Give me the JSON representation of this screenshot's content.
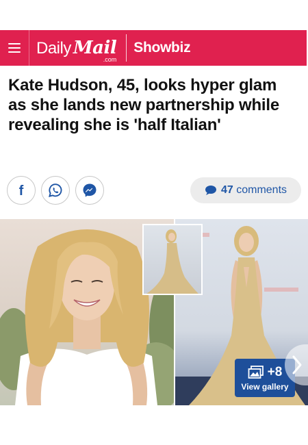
{
  "header": {
    "logo_daily": "Daily",
    "logo_mail": "Mail",
    "logo_com": ".com",
    "section": "Showbiz",
    "brand_color": "#e0214f"
  },
  "article": {
    "headline": "Kate Hudson, 45, looks hyper glam as she lands new partnership while revealing she is 'half Italian'"
  },
  "share": {
    "icons": [
      "facebook-icon",
      "whatsapp-icon",
      "messenger-icon"
    ]
  },
  "comments": {
    "count": "47",
    "label": "comments",
    "color": "#1f56a6"
  },
  "gallery": {
    "extra_count": "+8",
    "label": "View gallery",
    "badge_color": "#1e4f9a"
  }
}
